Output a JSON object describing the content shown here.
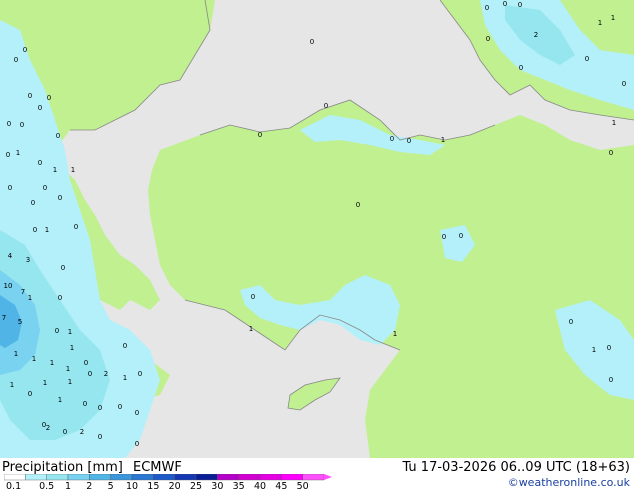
{
  "header": {
    "product": "Precipitation [mm]",
    "model": "ECMWF",
    "valid_time": "Tu 17-03-2026 06..09 UTC (18+63)",
    "credit": "©weatheronline.co.uk"
  },
  "legend": {
    "levels": [
      "0.1",
      "0.5",
      "1",
      "2",
      "5",
      "10",
      "15",
      "20",
      "25",
      "30",
      "35",
      "40",
      "45",
      "50"
    ],
    "colors": [
      "#ffffff",
      "#b4f0fa",
      "#96e6f0",
      "#78d2f0",
      "#50b4e6",
      "#3c96dc",
      "#2a78d2",
      "#1e5ac8",
      "#1438b4",
      "#0a1e96",
      "#b400c8",
      "#d200d2",
      "#e600e6",
      "#ff00ff",
      "#ff50ff"
    ]
  },
  "map": {
    "colors": {
      "sea": "#e6e6e6",
      "land": "#c0f090",
      "precip_light": "#b4f0fa",
      "precip_mid": "#96e6f0",
      "precip_heavy": "#78d2f0",
      "precip_strong": "#50b4e6",
      "coast": "#888888"
    },
    "values": [
      "0",
      "0",
      "0",
      "0",
      "0",
      "0",
      "0",
      "1",
      "0",
      "0",
      "0",
      "2",
      "0",
      "0",
      "0",
      "1",
      "1",
      "0",
      "1",
      "0",
      "1",
      "0",
      "0",
      "1",
      "0",
      "0",
      "0",
      "1",
      "0",
      "0",
      "0",
      "0",
      "0",
      "1",
      "1",
      "0",
      "0",
      "1",
      "0",
      "1",
      "0",
      "3",
      "4",
      "10",
      "7",
      "7",
      "5",
      "1",
      "1",
      "0",
      "1",
      "1",
      "1",
      "1",
      "0",
      "2",
      "1",
      "0",
      "1",
      "1",
      "0",
      "0",
      "0",
      "2",
      "2",
      "0",
      "0",
      "0",
      "1",
      "0",
      "1",
      "0",
      "0",
      "0",
      "0",
      "0",
      "1",
      "0",
      "0",
      "0",
      "0",
      "0",
      "0",
      "0",
      "0",
      "0"
    ]
  }
}
